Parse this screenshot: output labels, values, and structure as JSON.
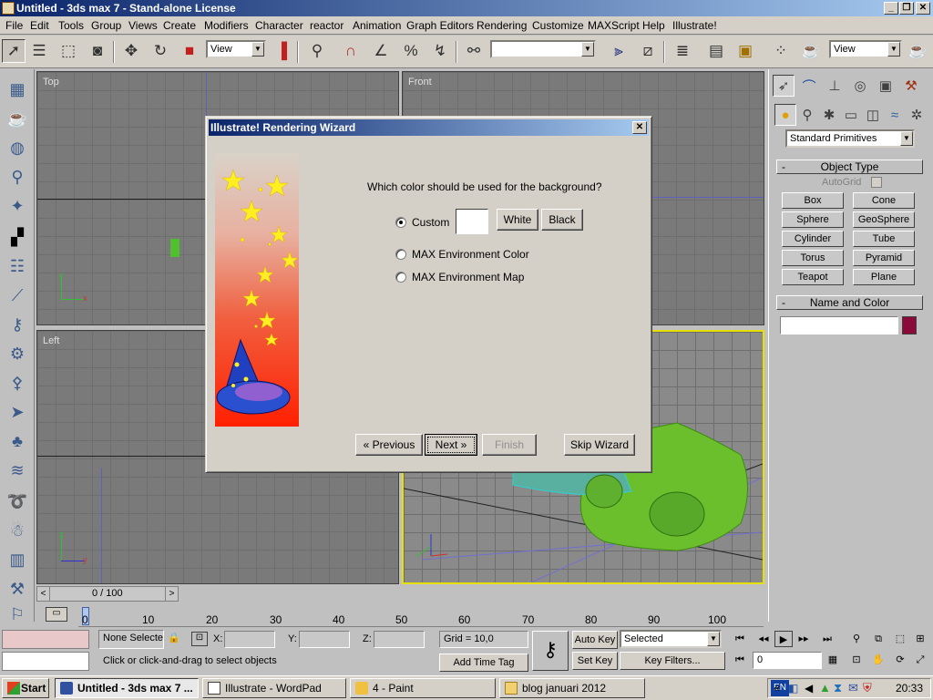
{
  "window": {
    "title": "Untitled - 3ds max 7 - Stand-alone License",
    "controls": [
      "_",
      "❐",
      "✕"
    ]
  },
  "menu": [
    "File",
    "Edit",
    "Tools",
    "Group",
    "Views",
    "Create",
    "Modifiers",
    "Character",
    "reactor",
    "Animation",
    "Graph Editors",
    "Rendering",
    "Customize",
    "MAXScript",
    "Help",
    "Illustrate!"
  ],
  "toolbar": {
    "ref_coord_left": "View",
    "named_selection": "",
    "ref_coord_right": "View"
  },
  "viewports": {
    "top": "Top",
    "front": "Front",
    "left": "Left",
    "perspective": ""
  },
  "dialog": {
    "title": "Illustrate! Rendering Wizard",
    "close": "✕",
    "question": "Which color should be used for the background?",
    "options": [
      {
        "label": "Custom",
        "selected": true
      },
      {
        "label": "MAX Environment Color",
        "selected": false
      },
      {
        "label": "MAX Environment Map",
        "selected": false
      }
    ],
    "swatch_color": "#ffffff",
    "white_label": "White",
    "black_label": "Black",
    "previous_label": "« Previous",
    "next_label": "Next »",
    "finish_label": "Finish",
    "skip_label": "Skip Wizard"
  },
  "command_panel": {
    "category_dropdown": "Standard Primitives",
    "object_type_header": "Object Type",
    "rollout_toggle": "-",
    "autogrid_label": "AutoGrid",
    "primitives": [
      "Box",
      "Cone",
      "Sphere",
      "GeoSphere",
      "Cylinder",
      "Tube",
      "Torus",
      "Pyramid",
      "Teapot",
      "Plane"
    ],
    "name_color_header": "Name and Color",
    "object_name": "",
    "object_color": "#8b0a3a"
  },
  "timeline": {
    "frame_display": "0 / 100",
    "ruler_labels": [
      "0",
      "10",
      "20",
      "30",
      "40",
      "50",
      "60",
      "70",
      "80",
      "90",
      "100"
    ],
    "prev": "<",
    "next": ">"
  },
  "status": {
    "selection": "None Selecte",
    "x_label": "X:",
    "y_label": "Y:",
    "z_label": "Z:",
    "x_value": "",
    "y_value": "",
    "z_value": "",
    "grid": "Grid = 10,0",
    "prompt": "Click or click-and-drag to select objects",
    "add_time_tag": "Add Time Tag",
    "auto_key": "Auto Key",
    "set_key": "Set Key",
    "selected_dropdown": "Selected",
    "key_filters": "Key Filters...",
    "current_frame": "0"
  },
  "taskbar": {
    "start": "Start",
    "tasks": [
      {
        "label": "Untitled - 3ds max 7 ...",
        "active": true
      },
      {
        "label": "Illustrate - WordPad",
        "active": false
      },
      {
        "label": "4 - Paint",
        "active": false
      },
      {
        "label": "blog januari 2012",
        "active": false
      }
    ],
    "lang": "EN",
    "tray_expand": "«",
    "clock": "20:33"
  }
}
